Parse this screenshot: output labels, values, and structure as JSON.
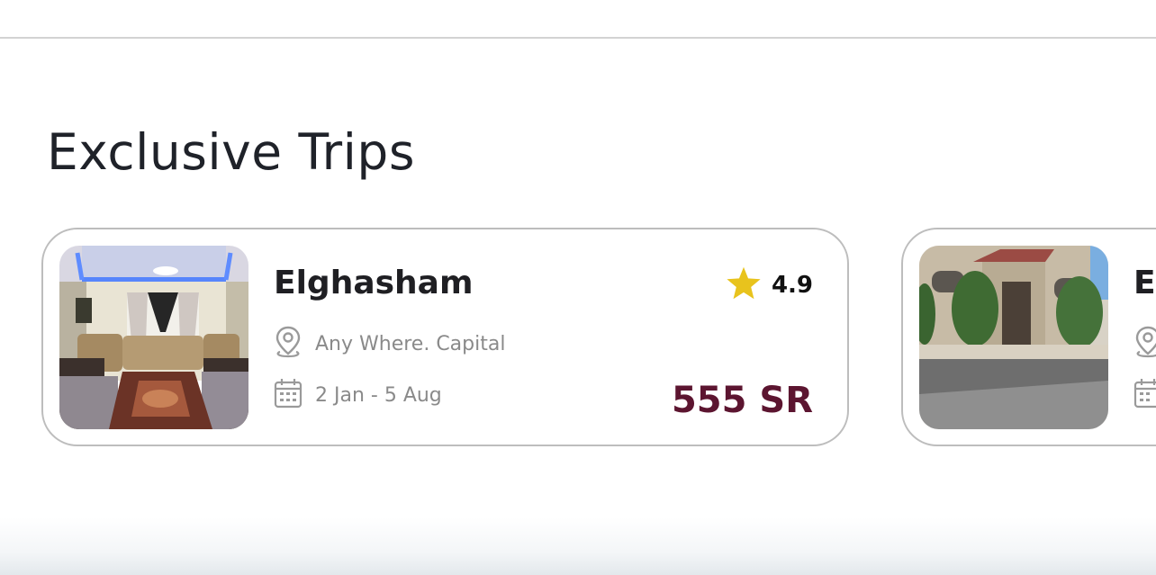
{
  "section": {
    "title": "Exclusive Trips"
  },
  "trips": [
    {
      "name": "Elghasham",
      "rating": "4.9",
      "location": "Any Where. Capital",
      "dates": "2 Jan - 5 Aug",
      "price": "555 SR"
    },
    {
      "name": "E"
    }
  ],
  "icons": {
    "rating": "star-icon",
    "location": "map-pin-icon",
    "dates": "calendar-icon"
  },
  "colors": {
    "price": "#5c1530",
    "star": "#e8c31d",
    "card_border": "#bdbdbd",
    "title": "#1f2229",
    "meta_text": "#8a8a8a"
  }
}
